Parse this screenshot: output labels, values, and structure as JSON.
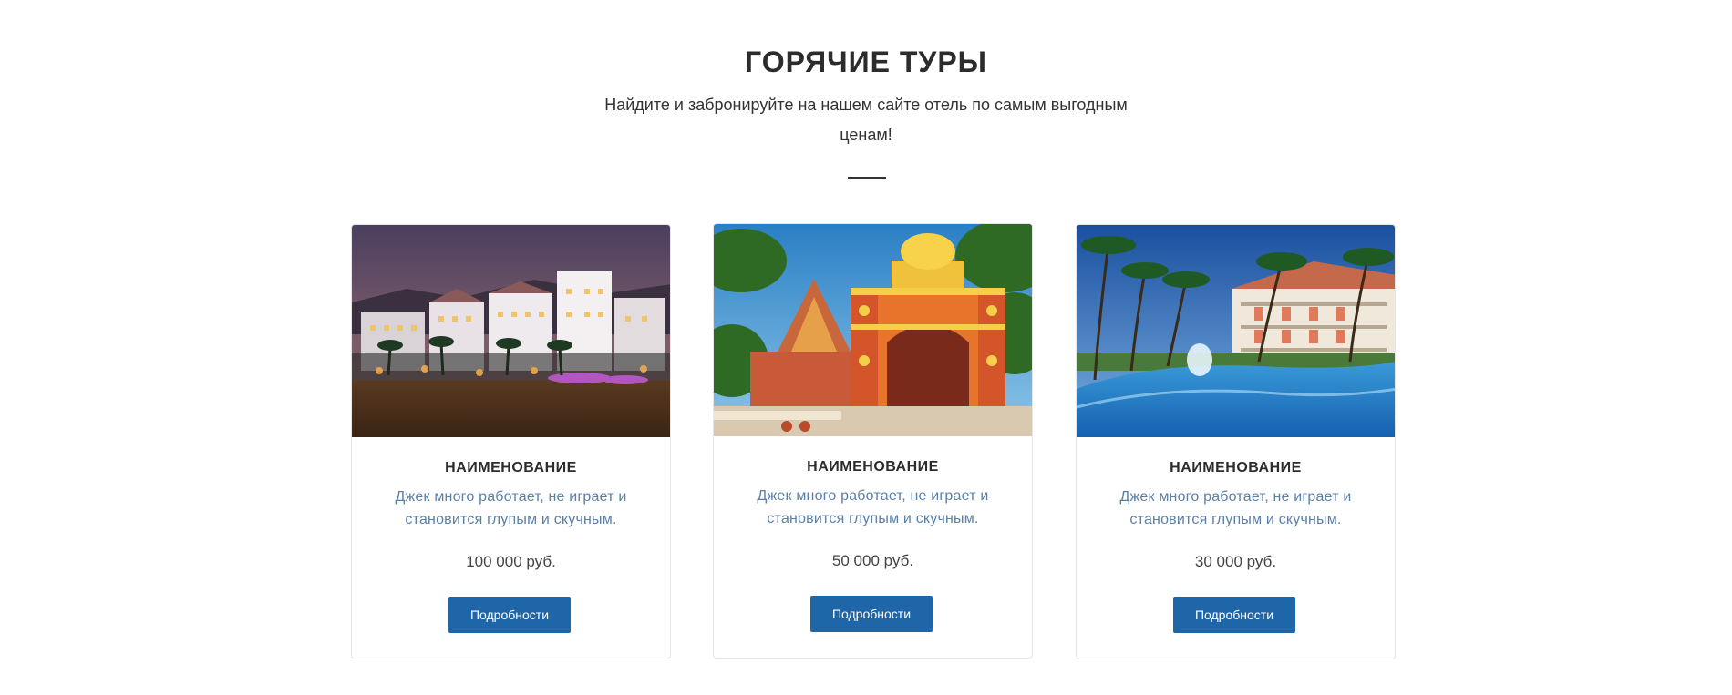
{
  "section": {
    "title": "ГОРЯЧИЕ ТУРЫ",
    "subtitle": "Найдите и забронируйте на нашем сайте отель по самым выгодным ценам!"
  },
  "tours": [
    {
      "name": "НАИМЕНОВАНИЕ",
      "description": "Джек много работает, не играет и становится глупым и скучным.",
      "price": "100 000 руб.",
      "button_label": "Подробности",
      "image": "night-hotel-waterfront-photo"
    },
    {
      "name": "НАИМЕНОВАНИЕ",
      "description": "Джек много работает, не играет и становится глупым и скучным.",
      "price": "50 000 руб.",
      "button_label": "Подробности",
      "image": "colorful-temple-gate-photo"
    },
    {
      "name": "НАИМЕНОВАНИЕ",
      "description": "Джек много работает, не играет и становится глупым и скучным.",
      "price": "30 000 руб.",
      "button_label": "Подробности",
      "image": "resort-pool-palms-photo"
    }
  ],
  "colors": {
    "button": "#1f66a8",
    "description": "#5b80a8",
    "title": "#2c2c2c"
  }
}
